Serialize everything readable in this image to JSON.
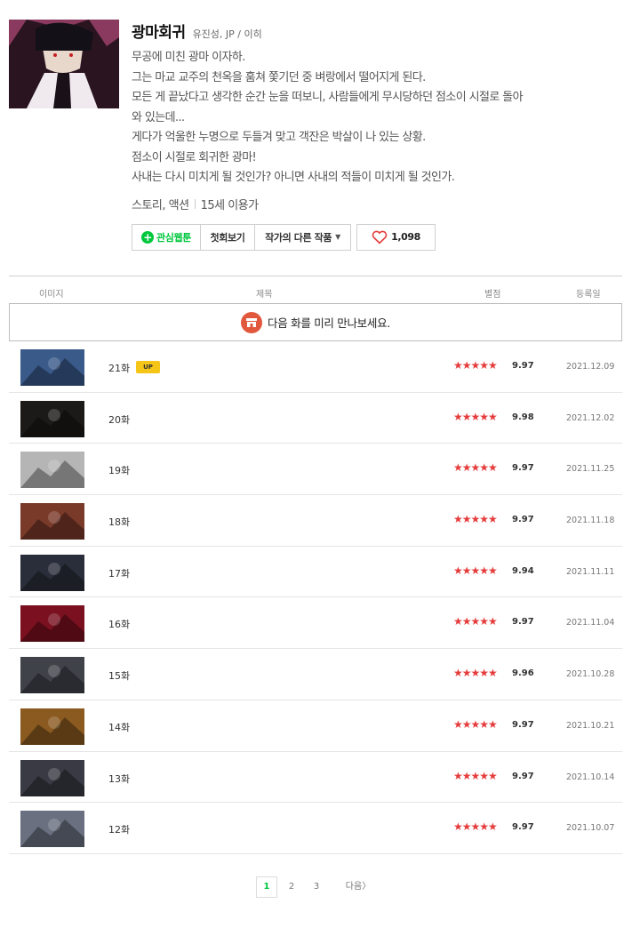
{
  "series": {
    "title": "광마회귀",
    "authors": "유진성, JP / 이히",
    "synopsis": [
      "무공에 미친 광마 이자하.",
      "그는 마교 교주의 천옥을 훔쳐 쫓기던 중 벼랑에서 떨어지게 된다.",
      "모든 게 끝났다고 생각한 순간 눈을 떠보니, 사람들에게 무시당하던 점소이 시절로 돌아",
      "와 있는데...",
      "게다가 억울한 누명으로 두들겨 맞고 객잔은 박살이 나 있는 상황.",
      "점소이 시절로 회귀한 광마!",
      "사내는 다시 미치게 될 것인가? 아니면 사내의 적들이 미치게 될 것인가."
    ],
    "genre": "스토리, 액션",
    "age": "15세 이용가"
  },
  "buttons": {
    "favorite": "관심웹툰",
    "first_episode": "첫회보기",
    "other_works": "작가의 다른 작품",
    "likes": "1,098"
  },
  "table": {
    "headers": {
      "image": "이미지",
      "title": "제목",
      "rating": "별점",
      "date": "등록일"
    },
    "preview_text": "다음 화를 미리 만나보세요.",
    "up_badge": "UP",
    "stars": "★★★★★",
    "episodes": [
      {
        "title": "21화",
        "up": true,
        "score": "9.97",
        "date": "2021.12.09",
        "color": "#3a5a8a"
      },
      {
        "title": "20화",
        "up": false,
        "score": "9.98",
        "date": "2021.12.02",
        "color": "#1c1a18"
      },
      {
        "title": "19화",
        "up": false,
        "score": "9.97",
        "date": "2021.11.25",
        "color": "#b5b5b5"
      },
      {
        "title": "18화",
        "up": false,
        "score": "9.97",
        "date": "2021.11.18",
        "color": "#7a3a2a"
      },
      {
        "title": "17화",
        "up": false,
        "score": "9.94",
        "date": "2021.11.11",
        "color": "#2a2e3a"
      },
      {
        "title": "16화",
        "up": false,
        "score": "9.97",
        "date": "2021.11.04",
        "color": "#7a1020"
      },
      {
        "title": "15화",
        "up": false,
        "score": "9.96",
        "date": "2021.10.28",
        "color": "#40424a"
      },
      {
        "title": "14화",
        "up": false,
        "score": "9.97",
        "date": "2021.10.21",
        "color": "#8a5a20"
      },
      {
        "title": "13화",
        "up": false,
        "score": "9.97",
        "date": "2021.10.14",
        "color": "#3a3a44"
      },
      {
        "title": "12화",
        "up": false,
        "score": "9.97",
        "date": "2021.10.07",
        "color": "#6a7080"
      }
    ]
  },
  "pagination": {
    "pages": [
      "1",
      "2",
      "3"
    ],
    "current": "1",
    "next": "다음"
  },
  "colors": {
    "accent_green": "#00c73c",
    "star_red": "#e53b3b",
    "up_badge_yellow": "#f5c518",
    "preview_icon": "#e2583c"
  }
}
